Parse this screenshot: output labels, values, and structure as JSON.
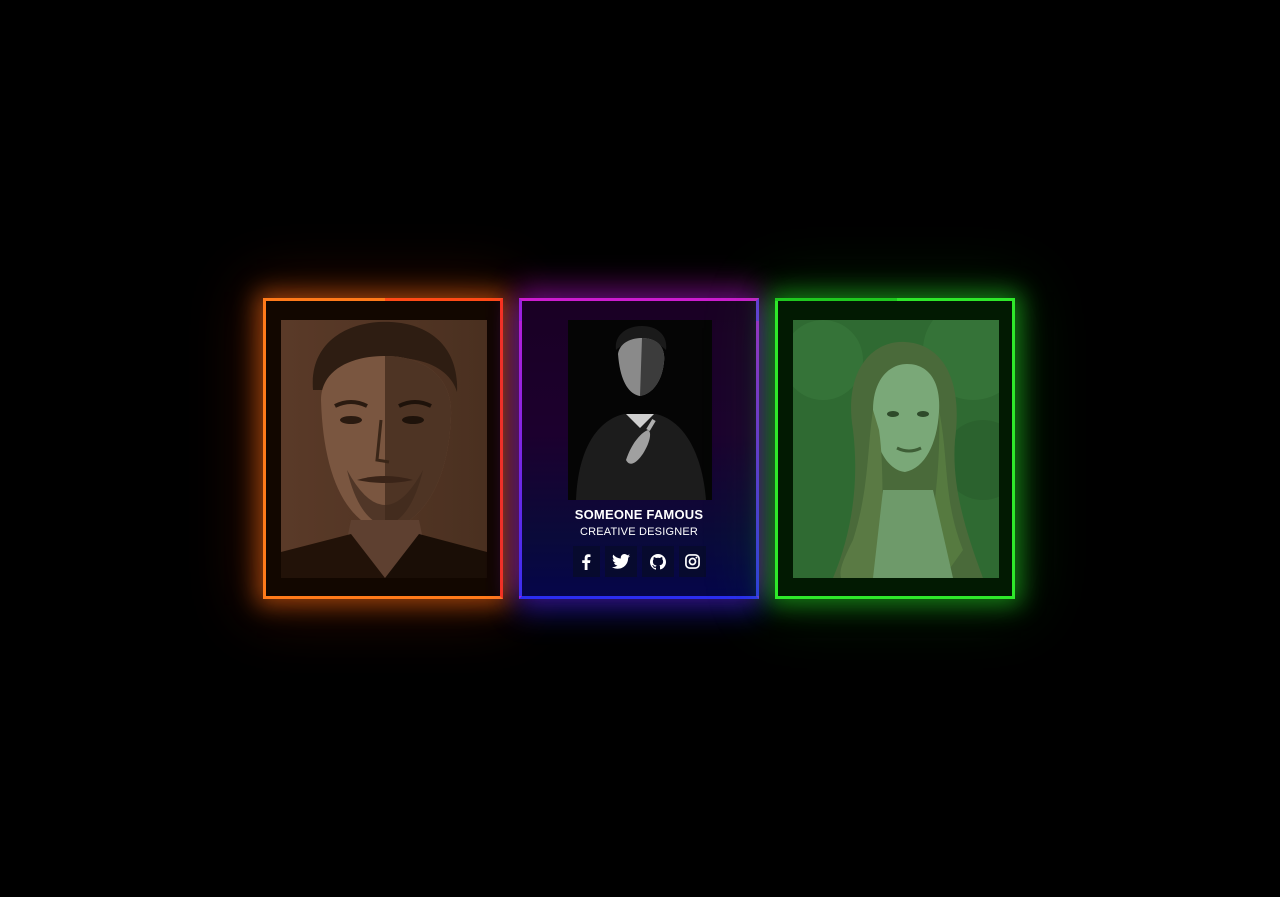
{
  "cards": [
    {
      "accent": "#ff7a1a",
      "secondary_accent": "#ff3414",
      "photo": "portrait-man-beard"
    },
    {
      "accent": "#cc1ccf",
      "secondary_accent": "#2b2df0",
      "photo": "portrait-man-dark",
      "name": "SOMEONE FAMOUS",
      "role": "CREATIVE DESIGNER",
      "socials": [
        {
          "icon": "facebook-icon"
        },
        {
          "icon": "twitter-icon"
        },
        {
          "icon": "github-icon"
        },
        {
          "icon": "instagram-icon"
        }
      ]
    },
    {
      "accent": "#2ee82a",
      "secondary_accent": "#1fc91f",
      "photo": "portrait-woman-long-hair"
    }
  ]
}
